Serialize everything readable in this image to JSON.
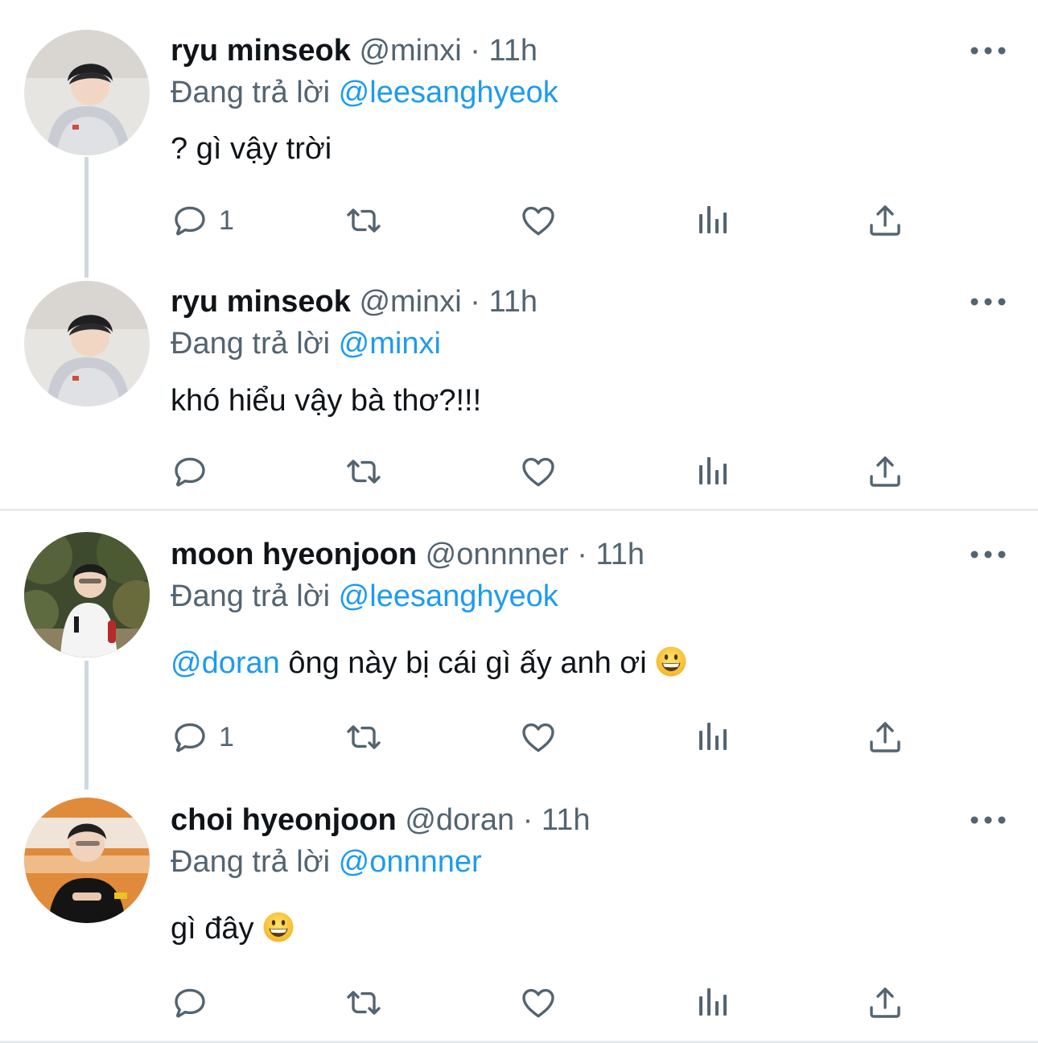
{
  "tweets": [
    {
      "name": "ryu minseok",
      "handle": "@minxi",
      "separator": "·",
      "time": "11h",
      "reply_prefix": "Đang trả lời",
      "reply_to": "@leesanghyeok",
      "text": "? gì vậy trời",
      "reply_count": "1",
      "avatar_icon": "avatar-photo-ryu-minseok"
    },
    {
      "name": "ryu minseok",
      "handle": "@minxi",
      "separator": "·",
      "time": "11h",
      "reply_prefix": "Đang trả lời",
      "reply_to": "@minxi",
      "text": "khó hiểu vậy bà thơ?!!!",
      "reply_count": "",
      "avatar_icon": "avatar-photo-ryu-minseok"
    },
    {
      "name": "moon hyeonjoon",
      "handle": "@onnnner",
      "separator": "·",
      "time": "11h",
      "reply_prefix": "Đang trả lời",
      "reply_to": "@leesanghyeok",
      "text_mention": "@doran",
      "text": " ông này bị cái gì ấy anh ơi ",
      "emoji": "grinning-face-emoji",
      "reply_count": "1",
      "avatar_icon": "avatar-photo-moon-hyeonjoon"
    },
    {
      "name": "choi hyeonjoon",
      "handle": "@doran",
      "separator": "·",
      "time": "11h",
      "reply_prefix": "Đang trả lời",
      "reply_to": "@onnnner",
      "text": "gì đây ",
      "emoji": "grinning-face-emoji",
      "reply_count": "",
      "avatar_icon": "avatar-photo-choi-hyeonjoon"
    }
  ],
  "icons": {
    "reply": "reply-icon",
    "retweet": "retweet-icon",
    "like": "heart-icon",
    "views": "views-icon",
    "share": "share-icon",
    "more": "more-icon"
  },
  "colors": {
    "link": "#1d9bf0",
    "muted": "#536471",
    "text": "#0f1419",
    "thread_line": "#cfd9de",
    "divider": "#e7ebee"
  }
}
